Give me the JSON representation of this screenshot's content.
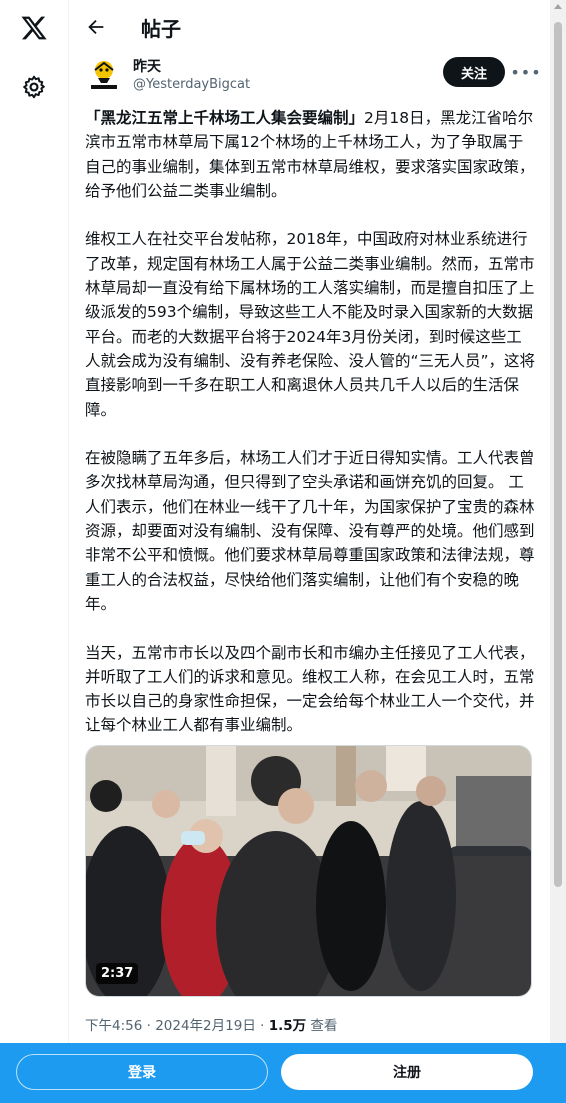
{
  "header": {
    "title": "帖子"
  },
  "author": {
    "name": "昨天",
    "handle": "@YesterdayBigcat",
    "avatar_text": "YESTERDAY"
  },
  "actions": {
    "follow": "关注",
    "more": "•••"
  },
  "post": {
    "headline": "「黑龙江五常上千林场工人集会要编制」",
    "p1_rest": "2月18日，黑龙江省哈尔滨市五常市林草局下属12个林场的上千林场工人，为了争取属于自己的事业编制，集体到五常市林草局维权，要求落实国家政策，给予他们公益二类事业编制。",
    "p2": "维权工人在社交平台发帖称，2018年，中国政府对林业系统进行了改革，规定国有林场工人属于公益二类事业编制。然而，五常市林草局却一直没有给下属林场的工人落实编制，而是擅自扣压了上级派发的593个编制，导致这些工人不能及时录入国家新的大数据平台。而老的大数据平台将于2024年3月份关闭，到时候这些工人就会成为没有编制、没有养老保险、没人管的“三无人员”，这将直接影响到一千多在职工人和离退休人员共几千人以后的生活保障。",
    "p3": "在被隐瞒了五年多后，林场工人们才于近日得知实情。工人代表曾多次找林草局沟通，但只得到了空头承诺和画饼充饥的回复。 工人们表示，他们在林业一线干了几十年，为国家保护了宝贵的森林资源，却要面对没有编制、没有保障、没有尊严的处境。他们感到非常不公平和愤慨。他们要求林草局尊重国家政策和法律法规，尊重工人的合法权益，尽快给他们落实编制，让他们有个安稳的晚年。",
    "p4": "当天，五常市市长以及四个副市长和市编办主任接见了工人代表，并听取了工人们的诉求和意见。维权工人称，在会见工人时，五常市长以自己的身家性命担保，一定会给每个林业工人一个交代，并让每个林业工人都有事业编制。"
  },
  "video": {
    "duration": "2:37"
  },
  "meta": {
    "time": "下午4:56 · 2024年2月19日 · ",
    "views_count": "1.5万",
    "views_label": " 查看"
  },
  "bottom": {
    "login": "登录",
    "signup": "注册"
  },
  "colors": {
    "accent": "#1d9bf0",
    "text": "#0f1419",
    "muted": "#536471"
  }
}
